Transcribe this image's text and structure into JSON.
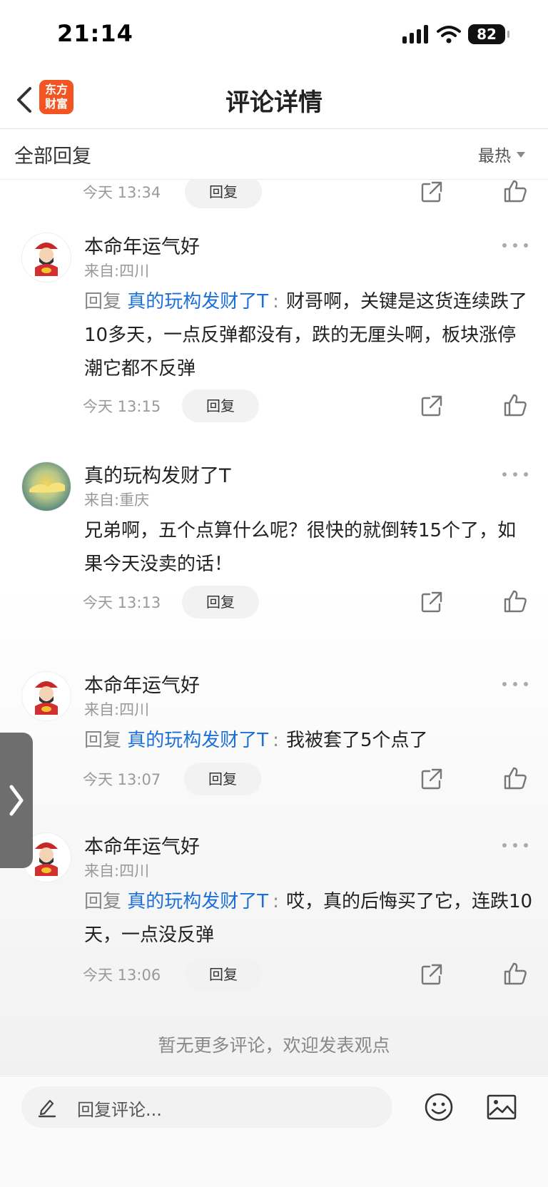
{
  "status_bar": {
    "time": "21:14",
    "battery": "82"
  },
  "nav": {
    "title": "评论详情",
    "logo_line1": "东方",
    "logo_line2": "财富"
  },
  "sub_header": {
    "title": "全部回复",
    "sort_label": "最热"
  },
  "top_action": {
    "time": "今天 13:34",
    "reply_label": "回复"
  },
  "comments": [
    {
      "user": "本命年运气好",
      "location": "来自:四川",
      "reply_prefix": "回复",
      "mention": "真的玩构发财了T",
      "colon": ":",
      "text": "财哥啊，关键是这货连续跌了10多天，一点反弹都没有，跌的无厘头啊，板块涨停潮它都不反弹",
      "time": "今天 13:15",
      "reply_label": "回复"
    },
    {
      "user": "真的玩构发财了T",
      "location": "来自:重庆",
      "text": "兄弟啊，五个点算什么呢？很快的就倒转15个了，如果今天没卖的话！",
      "time": "今天 13:13",
      "reply_label": "回复"
    },
    {
      "user": "本命年运气好",
      "location": "来自:四川",
      "reply_prefix": "回复",
      "mention": "真的玩构发财了T",
      "colon": ":",
      "text": "我被套了5个点了",
      "time": "今天 13:07",
      "reply_label": "回复"
    },
    {
      "user": "本命年运气好",
      "location": "来自:四川",
      "reply_prefix": "回复",
      "mention": "真的玩构发财了T",
      "colon": ":",
      "text": "哎，真的后悔买了它，连跌10天，一点没反弹",
      "time": "今天 13:06",
      "reply_label": "回复"
    }
  ],
  "end_message": "暂无更多评论，欢迎发表观点",
  "bottom_bar": {
    "placeholder": "回复评论..."
  },
  "colors": {
    "accent_blue": "#1a6fd8",
    "brand_orange": "#f25422"
  }
}
